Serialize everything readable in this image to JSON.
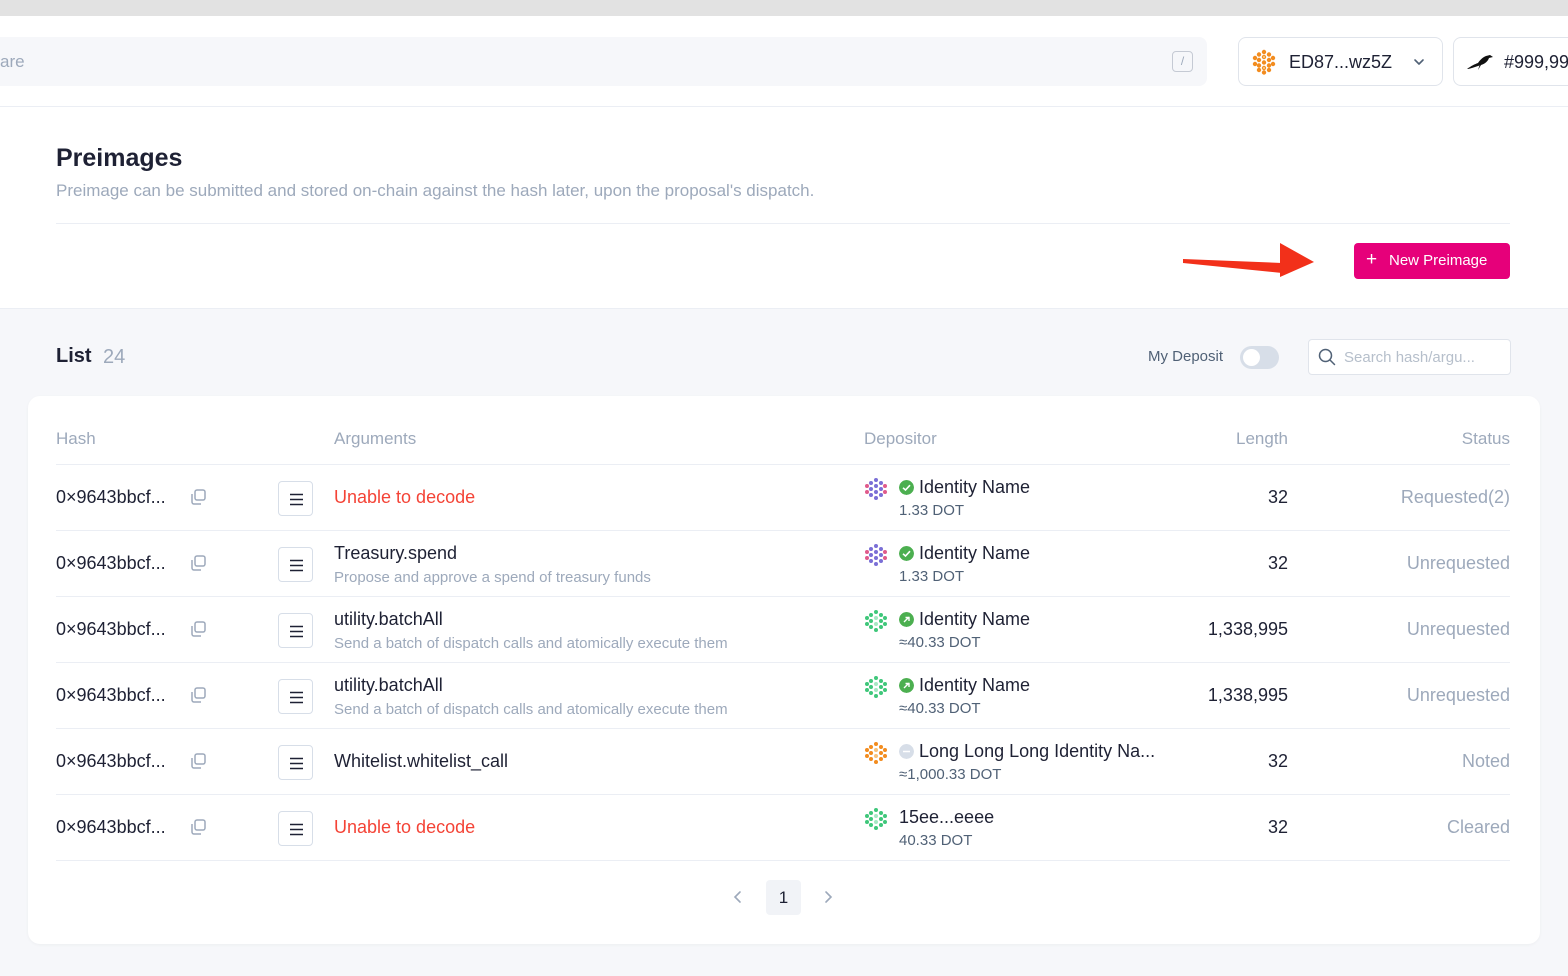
{
  "header": {
    "search_placeholder_visible": "are",
    "search_shortcut": "/",
    "account_name": "ED87...wz5Z",
    "block_number": "#999,99"
  },
  "page": {
    "title": "Preimages",
    "subtitle": "Preimage can be submitted and stored on-chain against the hash later, upon the proposal's dispatch.",
    "new_button_plus": "+",
    "new_button_label": "New Preimage"
  },
  "list": {
    "title": "List",
    "count": "24",
    "my_deposit_label": "My Deposit",
    "search_placeholder": "Search hash/argu..."
  },
  "table": {
    "headers": {
      "hash": "Hash",
      "arguments": "Arguments",
      "depositor": "Depositor",
      "length": "Length",
      "status": "Status"
    },
    "rows": [
      {
        "hash": "0×9643bbcf...",
        "arg_main": "Unable to decode",
        "arg_sub": "",
        "dep_name": "Identity Name",
        "dep_amount": "1.33 DOT",
        "length": "32",
        "status": "Requested(2)"
      },
      {
        "hash": "0×9643bbcf...",
        "arg_main": "Treasury.spend",
        "arg_sub": "Propose and approve a spend of treasury funds",
        "dep_name": "Identity Name",
        "dep_amount": "1.33 DOT",
        "length": "32",
        "status": "Unrequested"
      },
      {
        "hash": "0×9643bbcf...",
        "arg_main": "utility.batchAll",
        "arg_sub": "Send a batch of dispatch calls and atomically execute them",
        "dep_name": "Identity Name",
        "dep_amount": "≈40.33 DOT",
        "length": "1,338,995",
        "status": "Unrequested"
      },
      {
        "hash": "0×9643bbcf...",
        "arg_main": "utility.batchAll",
        "arg_sub": "Send a batch of dispatch calls and atomically execute them",
        "dep_name": "Identity Name",
        "dep_amount": "≈40.33 DOT",
        "length": "1,338,995",
        "status": "Unrequested"
      },
      {
        "hash": "0×9643bbcf...",
        "arg_main": "Whitelist.whitelist_call",
        "arg_sub": "",
        "dep_name": "Long Long Long Identity Na...",
        "dep_amount": "≈1,000.33 DOT",
        "length": "32",
        "status": "Noted"
      },
      {
        "hash": "0×9643bbcf...",
        "arg_main": "Unable to decode",
        "arg_sub": "",
        "dep_name": "15ee...eeee",
        "dep_amount": "40.33 DOT",
        "length": "32",
        "status": "Cleared"
      }
    ]
  },
  "pagination": {
    "current": "1"
  },
  "colors": {
    "accent": "#e6007a",
    "error": "#f44336",
    "verified": "#4caf50",
    "arrow": "#f2301a"
  }
}
